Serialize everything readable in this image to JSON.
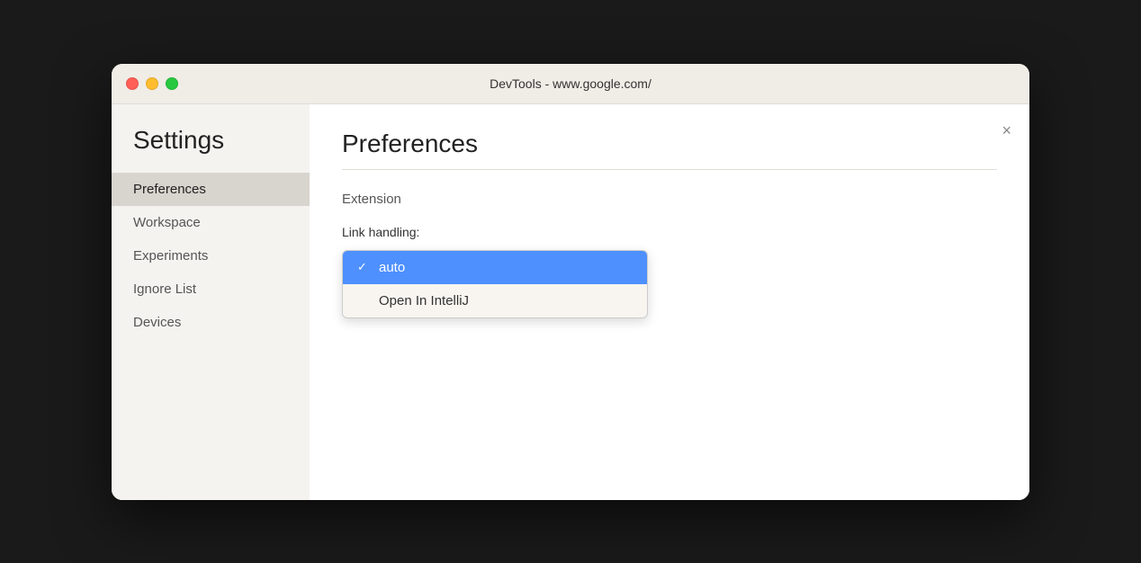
{
  "window": {
    "title": "DevTools - www.google.com/"
  },
  "titlebar": {
    "close_label": "×"
  },
  "sidebar": {
    "title": "Settings",
    "items": [
      {
        "id": "preferences",
        "label": "Preferences",
        "active": true
      },
      {
        "id": "workspace",
        "label": "Workspace",
        "active": false
      },
      {
        "id": "experiments",
        "label": "Experiments",
        "active": false
      },
      {
        "id": "ignore-list",
        "label": "Ignore List",
        "active": false
      },
      {
        "id": "devices",
        "label": "Devices",
        "active": false
      }
    ]
  },
  "main": {
    "title": "Preferences",
    "section_title": "Extension",
    "field_label": "Link handling:",
    "dropdown": {
      "options": [
        {
          "id": "auto",
          "label": "auto",
          "selected": true
        },
        {
          "id": "open-in-intellij",
          "label": "Open In IntelliJ",
          "selected": false
        }
      ]
    }
  },
  "icons": {
    "close": "×",
    "checkmark": "✓"
  }
}
